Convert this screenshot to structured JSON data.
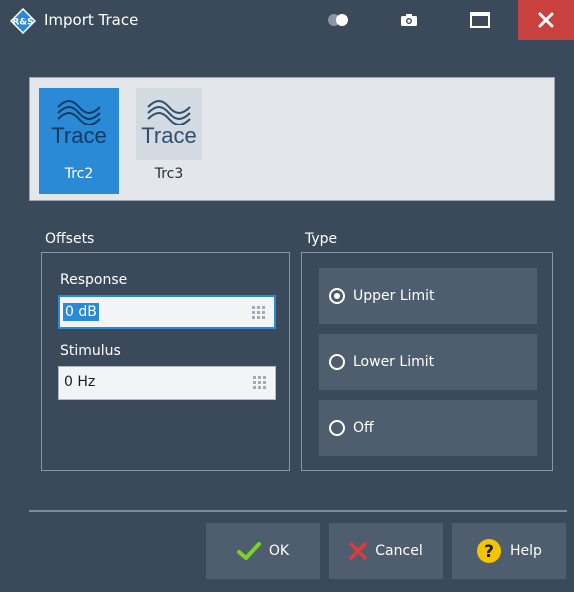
{
  "window": {
    "title": "Import Trace"
  },
  "traces": [
    {
      "label": "Trc2",
      "icon_text": "Trace",
      "selected": true
    },
    {
      "label": "Trc3",
      "icon_text": "Trace",
      "selected": false
    }
  ],
  "offsets": {
    "group_label": "Offsets",
    "response_label": "Response",
    "response_value": "0 dB",
    "stimulus_label": "Stimulus",
    "stimulus_value": "0 Hz"
  },
  "type": {
    "group_label": "Type",
    "options": [
      {
        "label": "Upper Limit",
        "selected": true
      },
      {
        "label": "Lower Limit",
        "selected": false
      },
      {
        "label": "Off",
        "selected": false
      }
    ]
  },
  "buttons": {
    "ok": "OK",
    "cancel": "Cancel",
    "help": "Help"
  },
  "colors": {
    "background": "#3b4a5a",
    "accent": "#2a8ad6",
    "close": "#c8403f",
    "ok_check": "#7ed321",
    "cancel_x": "#e03a3a",
    "help": "#f5c400"
  },
  "icons": {
    "title": "rs-logo-icon",
    "toggle": "toggle-icon",
    "screenshot": "camera-icon",
    "maximize": "maximize-icon",
    "close": "close-icon",
    "trace": "trace-wave-icon",
    "keypad": "keypad-icon",
    "ok": "checkmark-icon",
    "cancel": "x-icon",
    "help": "question-icon"
  }
}
